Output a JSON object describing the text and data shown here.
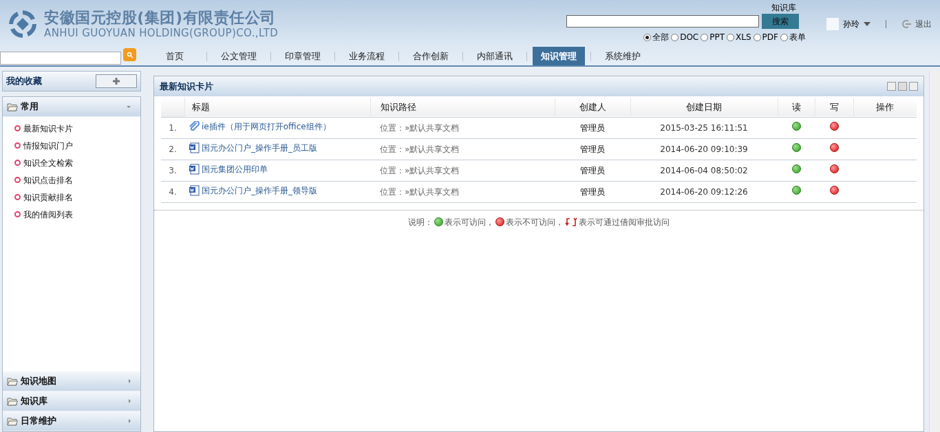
{
  "header": {
    "company_cn": "安徽国元控股(集团)有限责任公司",
    "company_en": "ANHUI GUOYUAN HOLDING(GROUP)CO.,LTD"
  },
  "search": {
    "label": "知识库",
    "button": "搜索",
    "options": [
      {
        "label": "全部",
        "selected": true
      },
      {
        "label": "DOC",
        "selected": false
      },
      {
        "label": "PPT",
        "selected": false
      },
      {
        "label": "XLS",
        "selected": false
      },
      {
        "label": "PDF",
        "selected": false
      },
      {
        "label": "表单",
        "selected": false
      }
    ]
  },
  "user": {
    "name": "孙玲",
    "logout": "退出"
  },
  "nav": {
    "tabs": [
      {
        "label": "首页",
        "selected": false
      },
      {
        "label": "公文管理",
        "selected": false
      },
      {
        "label": "印章管理",
        "selected": false
      },
      {
        "label": "业务流程",
        "selected": false
      },
      {
        "label": "合作创新",
        "selected": false
      },
      {
        "label": "内部通讯",
        "selected": false
      },
      {
        "label": "知识管理",
        "selected": true
      },
      {
        "label": "系统维护",
        "selected": false
      }
    ]
  },
  "sidebar": {
    "favorites_title": "我的收藏",
    "sections": [
      {
        "title": "常用",
        "expanded": true,
        "items": [
          "最新知识卡片",
          "情报知识门户",
          "知识全文检索",
          "知识点击排名",
          "知识贡献排名",
          "我的借阅列表"
        ]
      },
      {
        "title": "知识地图",
        "expanded": false
      },
      {
        "title": "知识库",
        "expanded": false
      },
      {
        "title": "日常维护",
        "expanded": false
      }
    ]
  },
  "panel": {
    "title": "最新知识卡片",
    "columns": [
      "标题",
      "知识路径",
      "创建人",
      "创建日期",
      "读",
      "写",
      "操作"
    ],
    "rows": [
      {
        "index": "1.",
        "kind": "attachment",
        "title": "ie插件（用于网页打开office组件）",
        "path": "位置：»默认共享文档",
        "creator": "管理员",
        "date": "2015-03-25 16:11:51",
        "read": true,
        "write": false
      },
      {
        "index": "2.",
        "kind": "word",
        "title": "国元办公门户_操作手册_员工版",
        "path": "位置：»默认共享文档",
        "creator": "管理员",
        "date": "2014-06-20 09:10:39",
        "read": true,
        "write": false
      },
      {
        "index": "3.",
        "kind": "word",
        "title": "国元集团公用印单",
        "path": "位置：»默认共享文档",
        "creator": "管理员",
        "date": "2014-06-04 08:50:02",
        "read": true,
        "write": false
      },
      {
        "index": "4.",
        "kind": "word",
        "title": "国元办公门户_操作手册_领导版",
        "path": "位置：»默认共享文档",
        "creator": "管理员",
        "date": "2014-06-20 09:12:26",
        "read": true,
        "write": false
      }
    ],
    "legend": {
      "label": "说明：",
      "items": [
        {
          "kind": "allowed",
          "text": "表示可访问，"
        },
        {
          "kind": "denied",
          "text": "表示不可访问，"
        },
        {
          "kind": "borrow",
          "text": "表示可通过借阅审批访问"
        }
      ]
    }
  }
}
